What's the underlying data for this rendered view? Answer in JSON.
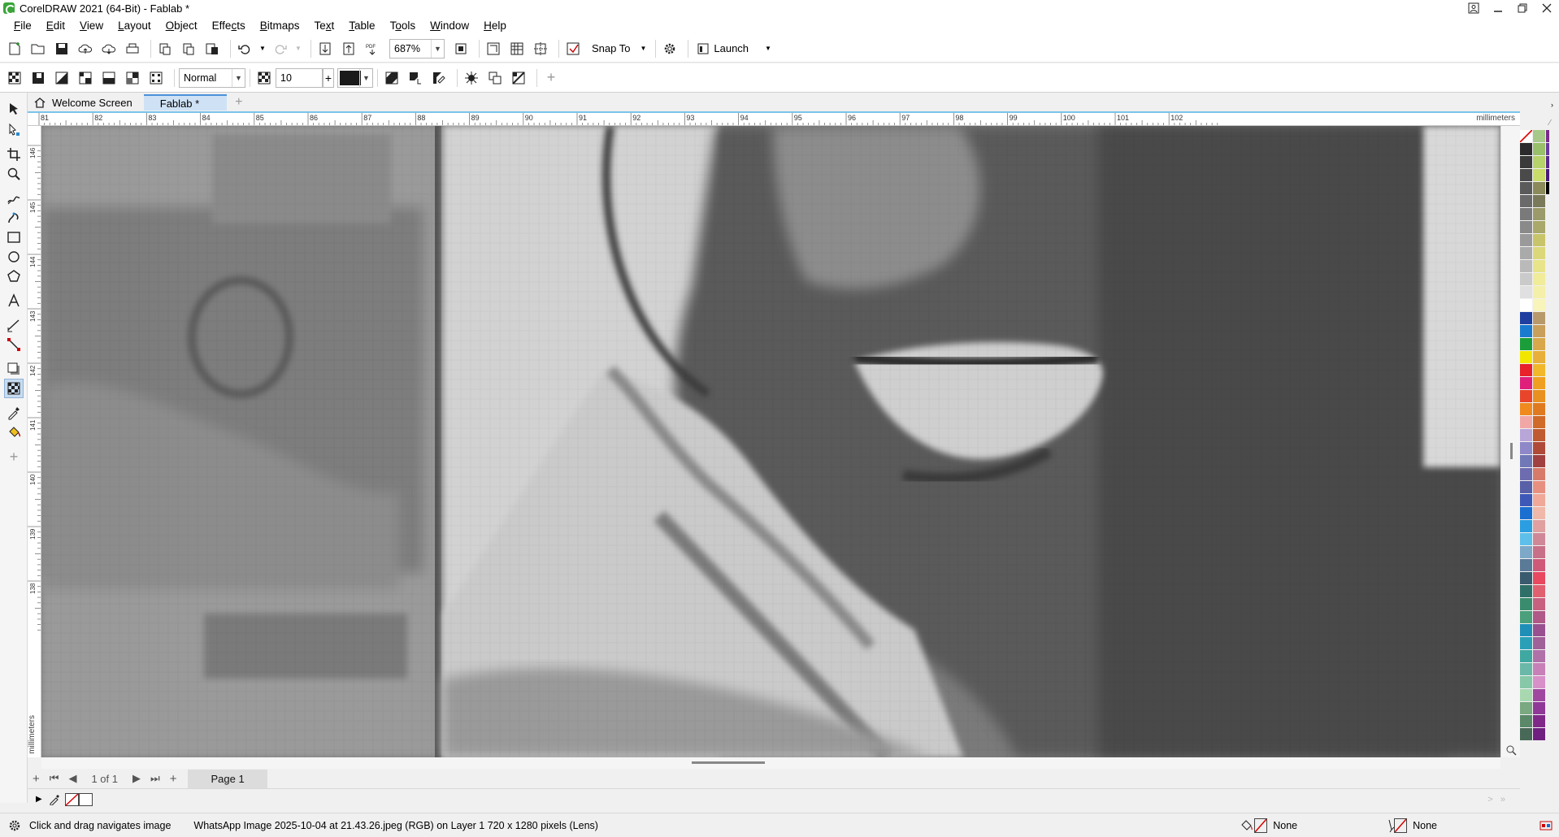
{
  "window": {
    "title": "CorelDRAW 2021 (64-Bit) - Fablab *"
  },
  "menu": [
    {
      "u": "F",
      "rest": "ile"
    },
    {
      "u": "E",
      "rest": "dit"
    },
    {
      "u": "V",
      "rest": "iew"
    },
    {
      "u": "L",
      "rest": "ayout"
    },
    {
      "u": "O",
      "rest": "bject"
    },
    {
      "u": "",
      "rest": "Effe",
      "u2": "c",
      "rest2": "ts"
    },
    {
      "u": "B",
      "rest": "itmaps"
    },
    {
      "u": "",
      "rest": "Te",
      "u2": "x",
      "rest2": "t"
    },
    {
      "u": "T",
      "rest": "able"
    },
    {
      "u": "",
      "rest": "T",
      "u2": "o",
      "rest2": "ols"
    },
    {
      "u": "W",
      "rest": "indow"
    },
    {
      "u": "H",
      "rest": "elp"
    }
  ],
  "toolbar": {
    "zoom_value": "687%",
    "snap_to_label": "Snap To",
    "launch_label": "Launch"
  },
  "property_bar": {
    "merge_mode": "Normal",
    "nib_size": "10",
    "color_hex": "#1a1a1a"
  },
  "tabs": [
    {
      "label": "Welcome Screen",
      "active": false
    },
    {
      "label": "Fablab *",
      "active": true
    }
  ],
  "ruler": {
    "unit": "millimeters",
    "h_ticks": [
      "81",
      "82",
      "83",
      "84",
      "85",
      "86",
      "87",
      "88",
      "89",
      "90",
      "91",
      "92",
      "93",
      "94",
      "95",
      "96",
      "97",
      "98",
      "99",
      "100",
      "101",
      "102"
    ],
    "v_ticks": [
      "146",
      "145",
      "144",
      "143",
      "142",
      "141",
      "140",
      "139",
      "138"
    ]
  },
  "page_nav": {
    "count": "1 of 1",
    "page_tab": "Page 1"
  },
  "status": {
    "hint": "Click and drag navigates image",
    "info": "WhatsApp Image 2025-10-04 at 21.43.26.jpeg (RGB) on Layer 1 720 x 1280 pixels  (Lens)",
    "fill": "None",
    "outline": "None"
  },
  "palette": {
    "col1": [
      "#ffffff",
      "#2b2b2b",
      "#3a3a3a",
      "#4a4a4a",
      "#5a5a5a",
      "#6a6a6a",
      "#7a7a7a",
      "#8a8a8a",
      "#9a9a9a",
      "#aaaaaa",
      "#bababa",
      "#cacaca",
      "#e0e0e0",
      "#ffffff",
      "#1f3fa0",
      "#1a7ad0",
      "#1b9e3a",
      "#f2e600",
      "#e8212a",
      "#e01f7a",
      "#e8452b",
      "#f08a1e",
      "#f2a7a7",
      "#b8a6d8",
      "#8e88c8",
      "#7078b8",
      "#6e6cb0",
      "#5860a8",
      "#3e58b8",
      "#1b6fd0",
      "#2a9ee0",
      "#5ec0ea",
      "#7ea8c8",
      "#5a7a98",
      "#3a5a6e",
      "#2e7068",
      "#3a8c6e",
      "#4aa07a",
      "#1f8fb8",
      "#2aa0b8",
      "#3fa8a0",
      "#6ab8a8",
      "#86c8a8",
      "#a8d8b0",
      "#7aa880",
      "#5a8868",
      "#486858"
    ],
    "col2": [
      "#a6c98a",
      "#98bf6a",
      "#b6d26a",
      "#c8dc6a",
      "#8a8a5a",
      "#7a7a5a",
      "#9a9a6a",
      "#aaa86a",
      "#c8c46a",
      "#dcd87a",
      "#e8e48a",
      "#f0ec9a",
      "#f4f0aa",
      "#f8f4ba",
      "#b89a6a",
      "#c8a05a",
      "#d8a84a",
      "#e8b03a",
      "#f0b82a",
      "#f0a020",
      "#e89020",
      "#e07a20",
      "#d06a28",
      "#c05a30",
      "#b04a38",
      "#a04040",
      "#d87a6a",
      "#e89080",
      "#f0a898",
      "#f0b8a8",
      "#e0a0a0",
      "#d08898",
      "#c87088",
      "#d05878",
      "#e84860",
      "#e06070",
      "#c86080",
      "#b05888",
      "#985090",
      "#a06098",
      "#b070a8",
      "#c880b8",
      "#d890c8",
      "#a048a0",
      "#903898",
      "#802888",
      "#702080"
    ],
    "col3": [
      "#7a2a8a",
      "#6a3a9a",
      "#5a2a8a",
      "#4a1a7a",
      "#000000"
    ]
  }
}
